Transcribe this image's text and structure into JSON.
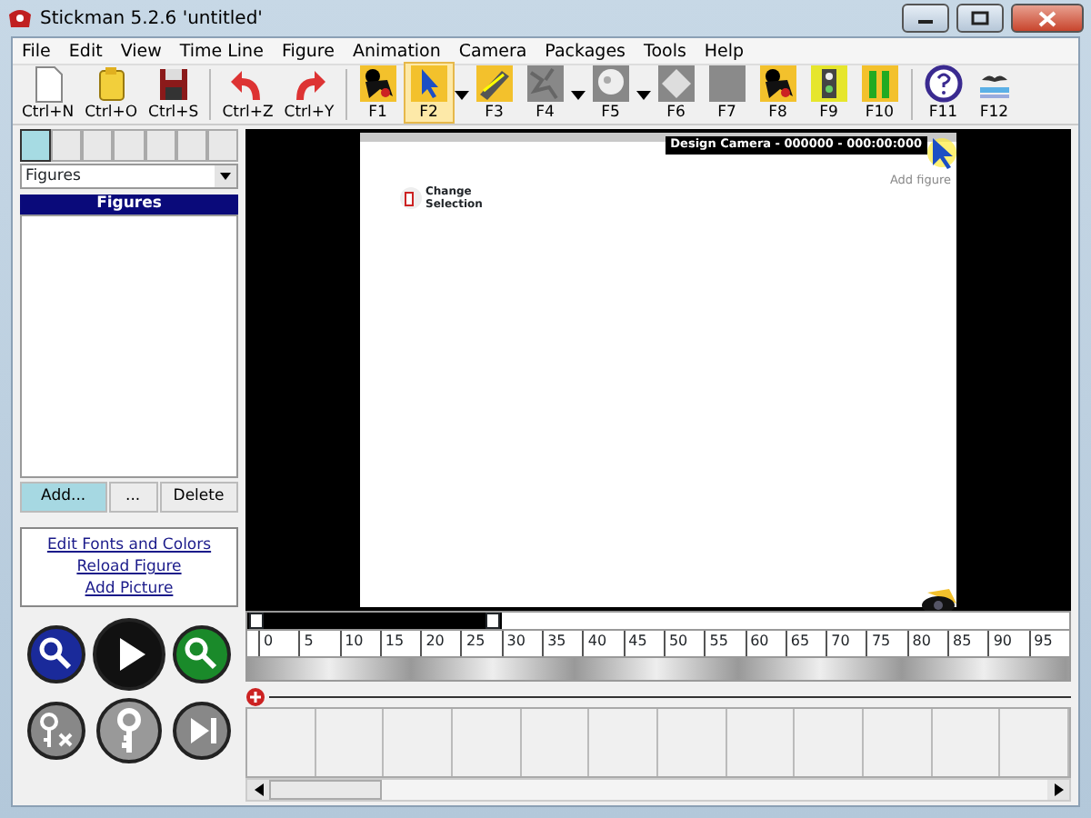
{
  "window": {
    "title": "Stickman 5.2.6  'untitled'"
  },
  "menu": [
    "File",
    "Edit",
    "View",
    "Time Line",
    "Figure",
    "Animation",
    "Camera",
    "Packages",
    "Tools",
    "Help"
  ],
  "toolbar": [
    {
      "kind": "button",
      "label": "Ctrl+N",
      "selected": false
    },
    {
      "kind": "button",
      "label": "Ctrl+O",
      "selected": false
    },
    {
      "kind": "button",
      "label": "Ctrl+S",
      "selected": false
    },
    {
      "kind": "separator"
    },
    {
      "kind": "button",
      "label": "Ctrl+Z",
      "selected": false
    },
    {
      "kind": "button",
      "label": "Ctrl+Y",
      "selected": false
    },
    {
      "kind": "separator"
    },
    {
      "kind": "button",
      "label": "F1",
      "selected": false
    },
    {
      "kind": "button",
      "label": "F2",
      "selected": true
    },
    {
      "kind": "caret"
    },
    {
      "kind": "button",
      "label": "F3",
      "selected": false
    },
    {
      "kind": "button",
      "label": "F4",
      "selected": false
    },
    {
      "kind": "caret"
    },
    {
      "kind": "button",
      "label": "F5",
      "selected": false
    },
    {
      "kind": "caret"
    },
    {
      "kind": "button",
      "label": "F6",
      "selected": false
    },
    {
      "kind": "button",
      "label": "F7",
      "selected": false
    },
    {
      "kind": "button",
      "label": "F8",
      "selected": false
    },
    {
      "kind": "button",
      "label": "F9",
      "selected": false
    },
    {
      "kind": "button",
      "label": "F10",
      "selected": false
    },
    {
      "kind": "separator"
    },
    {
      "kind": "button",
      "label": "F11",
      "selected": false
    },
    {
      "kind": "button",
      "label": "F12",
      "selected": false
    }
  ],
  "panel_tabs": [
    {
      "selected": true
    },
    {
      "selected": false
    },
    {
      "selected": false
    },
    {
      "selected": false
    },
    {
      "selected": false
    },
    {
      "selected": false
    },
    {
      "selected": false
    }
  ],
  "category_select": {
    "value": "Figures"
  },
  "figures_list": {
    "header": "Figures"
  },
  "list_buttons": [
    {
      "label": "Add...",
      "selected": true
    },
    {
      "label": "...",
      "selected": false
    },
    {
      "label": "Delete",
      "selected": false
    }
  ],
  "links": [
    "Edit Fonts and Colors",
    "Reload Figure",
    "Add Picture"
  ],
  "canvas": {
    "camera_label": "Design Camera - 000000 - 000:00:000",
    "add_figure": "Add figure",
    "change_selection": "Change Selection"
  },
  "timeline": {
    "range": {
      "level": 0.31
    },
    "ticks": [
      "0",
      "5",
      "10",
      "15",
      "20",
      "25",
      "30",
      "35",
      "40",
      "45",
      "50",
      "55",
      "60",
      "65",
      "70",
      "75",
      "80",
      "85",
      "90",
      "95"
    ]
  }
}
